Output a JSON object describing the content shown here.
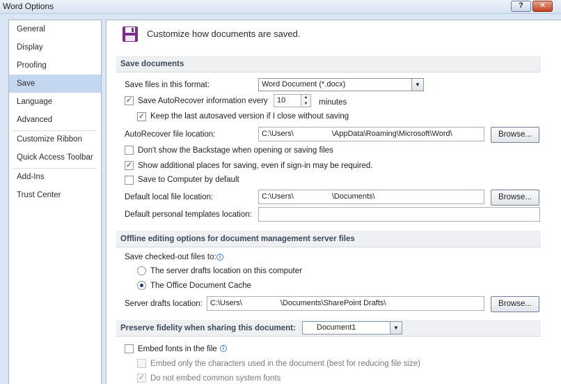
{
  "window": {
    "title": "Word Options",
    "help_label": "?",
    "close_label": "✕"
  },
  "nav": {
    "items": [
      {
        "label": "General"
      },
      {
        "label": "Display"
      },
      {
        "label": "Proofing"
      },
      {
        "label": "Save",
        "selected": true
      },
      {
        "label": "Language"
      },
      {
        "label": "Advanced"
      },
      {
        "label": "Customize Ribbon"
      },
      {
        "label": "Quick Access Toolbar"
      },
      {
        "label": "Add-Ins"
      },
      {
        "label": "Trust Center"
      }
    ]
  },
  "header": {
    "icon": "save-floppy-icon",
    "text": "Customize how documents are saved."
  },
  "save_documents": {
    "section_title": "Save documents",
    "format_label": "Save files in this format:",
    "format_value": "Word Document (*.docx)",
    "autorecover_label": "Save AutoRecover information every",
    "autorecover_checked": true,
    "autorecover_minutes": "10",
    "minutes_label": "minutes",
    "keep_last_label": "Keep the last autosaved version if I close without saving",
    "keep_last_checked": true,
    "autorecover_location_label": "AutoRecover file location:",
    "autorecover_location_value": "C:\\Users\\                  \\AppData\\Roaming\\Microsoft\\Word\\",
    "browse_label": "Browse...",
    "backstage_label": "Don't show the Backstage when opening or saving files",
    "backstage_checked": false,
    "additional_places_label": "Show additional places for saving, even if sign-in may be required.",
    "additional_places_checked": true,
    "save_to_computer_label": "Save to Computer by default",
    "save_to_computer_checked": false,
    "default_local_label": "Default local file location:",
    "default_local_value": "C:\\Users\\                  \\Documents\\",
    "default_templates_label": "Default personal templates location:",
    "default_templates_value": ""
  },
  "offline": {
    "section_title": "Offline editing options for document management server files",
    "checked_out_label": "Save checked-out files to:",
    "option_server_drafts": "The server drafts location on this computer",
    "option_office_cache": "The Office Document Cache",
    "selected_option": "office_cache",
    "server_drafts_label": "Server drafts location:",
    "server_drafts_value": "C:\\Users\\                  \\Documents\\SharePoint Drafts\\",
    "browse_label": "Browse..."
  },
  "fidelity": {
    "section_title": "Preserve fidelity when sharing this document:",
    "document_value": "Document1",
    "embed_fonts_label": "Embed fonts in the file",
    "embed_fonts_checked": false,
    "embed_only_label": "Embed only the characters used in the document (best for reducing file size)",
    "embed_only_checked": false,
    "no_common_label": "Do not embed common system fonts",
    "no_common_checked": true
  },
  "colors": {
    "nav_selected": "#c3d7f0",
    "section_bg": "#eef0f2",
    "save_icon": "#7a2e8a",
    "window_bg": "#dbe6f4"
  }
}
